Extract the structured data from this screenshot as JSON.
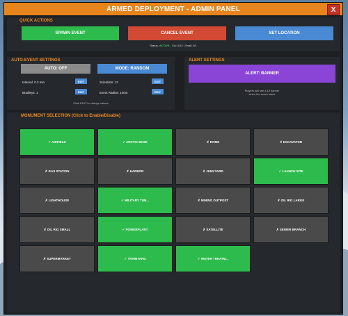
{
  "window": {
    "title": "ARMED DEPLOYMENT - ADMIN PANEL",
    "close_label": "X"
  },
  "colors": {
    "accent": "#e8841c",
    "enabled": "#2ebb4d",
    "disabled": "#4a4a4a",
    "close": "#c83224"
  },
  "quick_actions": {
    "heading": "QUICK ACTIONS",
    "spawn_label": "SPAWN EVENT",
    "cancel_label": "CANCEL EVENT",
    "set_location_label": "SET LOCATION",
    "status_prefix": "Status:",
    "status_value": "ACTIVE",
    "status_rest": "- Sci: 0/12 | Snail: 0/1"
  },
  "auto_event": {
    "heading": "AUTO-EVENT SETTINGS",
    "auto_label": "AUTO: OFF",
    "mode_label": "MODE: RANDOM",
    "interval_label": "Interval: 0.3 min",
    "bradleys_label": "Bradleys: 1",
    "scientists_label": "Scientists: 12",
    "radius_label": "Event Radius: 100m",
    "edit_label": "EDIT",
    "hint": "Click EDIT to change values"
  },
  "alert": {
    "heading": "ALERT SETTINGS",
    "alert_label": "ALERT: BANNER",
    "hint_line1": "Players will see a UI banner",
    "hint_line2": "when the event starts"
  },
  "monuments": {
    "heading": "MONUMENT SELECTION (Click to Enable/Disable)",
    "items": [
      {
        "label": "✓ AIRFIELD",
        "enabled": true
      },
      {
        "label": "✓ ARCTIC BASE",
        "enabled": true
      },
      {
        "label": "✗ DOME",
        "enabled": false
      },
      {
        "label": "✗ EXCAVATOR",
        "enabled": false
      },
      {
        "label": "✗ GAS STATION",
        "enabled": false
      },
      {
        "label": "✗ HARBOR",
        "enabled": false
      },
      {
        "label": "✗ JUNKYARD",
        "enabled": false
      },
      {
        "label": "✓ LAUNCH SITE",
        "enabled": true
      },
      {
        "label": "✗ LIGHTHOUSE",
        "enabled": false
      },
      {
        "label": "✓ MILITARY TUN...",
        "enabled": true
      },
      {
        "label": "✗ MINING OUTPOST",
        "enabled": false
      },
      {
        "label": "✗ OIL RIG LARGE",
        "enabled": false
      },
      {
        "label": "✗ OIL RIG SMALL",
        "enabled": false
      },
      {
        "label": "✓ POWERPLANT",
        "enabled": true
      },
      {
        "label": "✗ SATELLITE",
        "enabled": false
      },
      {
        "label": "✗ SEWER BRANCH",
        "enabled": false
      },
      {
        "label": "✗ SUPERMARKET",
        "enabled": false
      },
      {
        "label": "✓ TRAINYARD",
        "enabled": true
      },
      {
        "label": "✓ WATER TREATM...",
        "enabled": true
      }
    ]
  }
}
